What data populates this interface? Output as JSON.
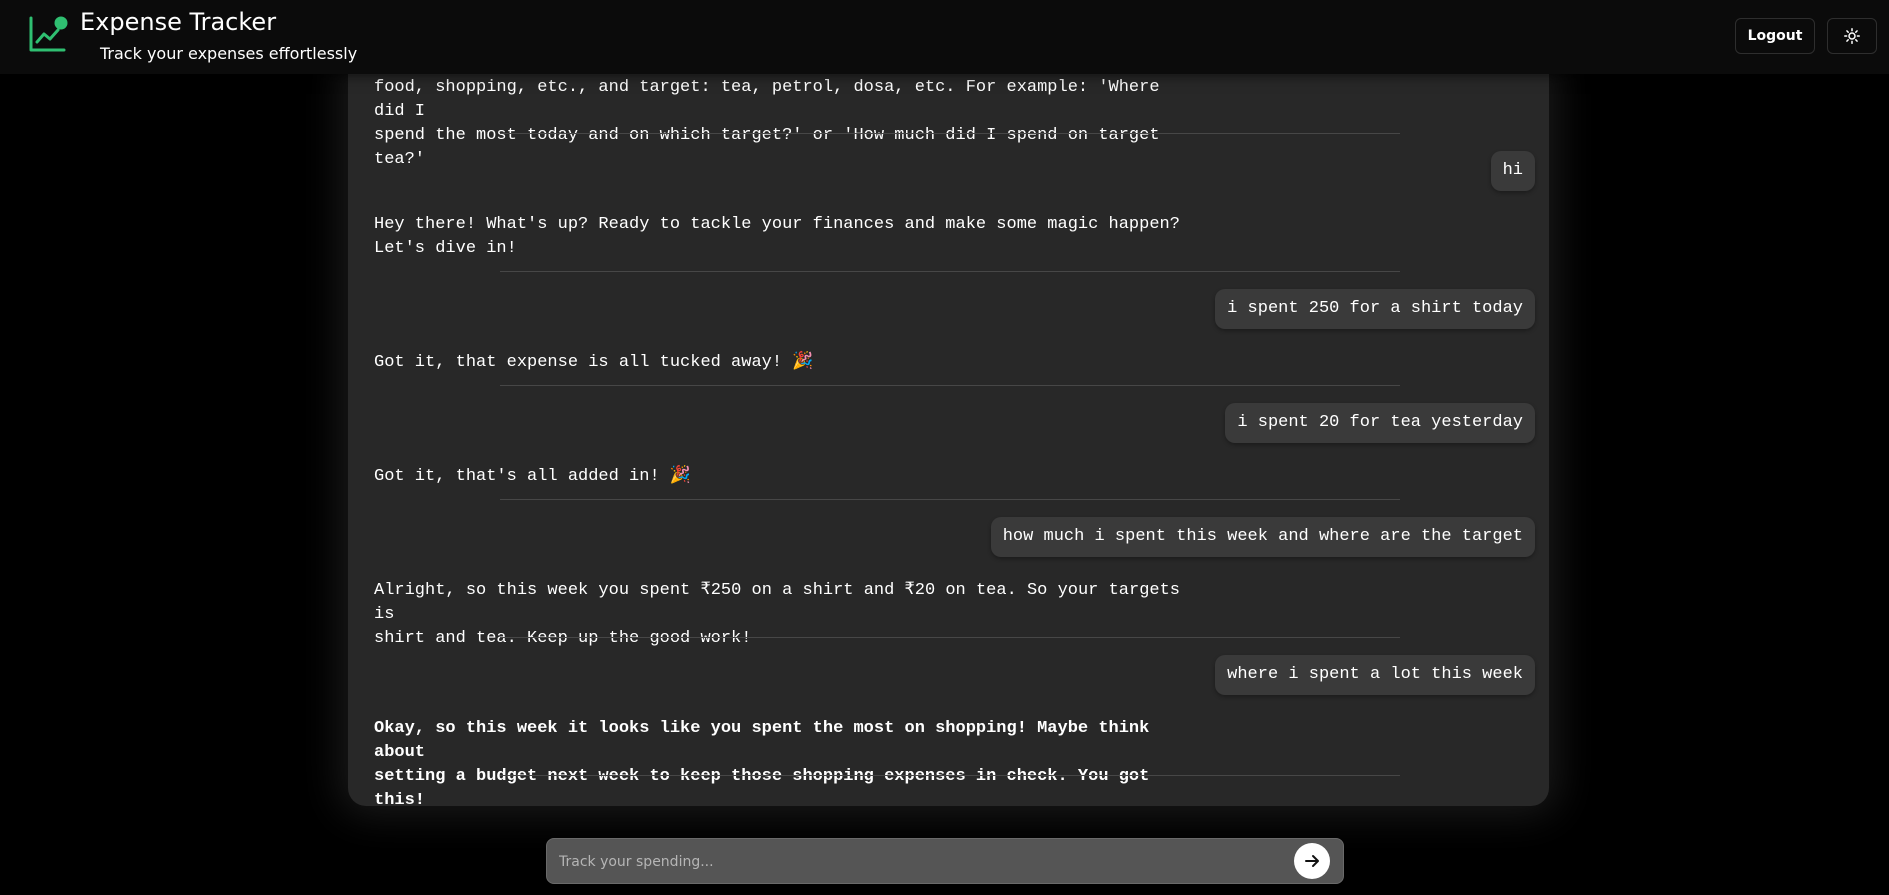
{
  "header": {
    "title": "Expense Tracker",
    "subtitle": "Track your expenses effortlessly",
    "logout_label": "Logout",
    "theme_icon": "sun-icon",
    "logo_icon": "chart-line-icon",
    "accent_color": "#2fbf71"
  },
  "chat": {
    "messages": [
      {
        "role": "bot",
        "text": "food, shopping, etc., and target: tea, petrol, dosa, etc. For example: 'Where did I\nspend the most today and on which target?' or 'How much did I spend on target tea?'"
      },
      {
        "role": "user",
        "text": "hi"
      },
      {
        "role": "bot",
        "text": "Hey there! What's up? Ready to tackle your finances and make some magic happen?\nLet's dive in!"
      },
      {
        "role": "user",
        "text": "i spent 250 for a shirt today"
      },
      {
        "role": "bot",
        "text": "Got it, that expense is all tucked away! 🎉"
      },
      {
        "role": "user",
        "text": "i spent 20 for tea yesterday"
      },
      {
        "role": "bot",
        "text": "Got it, that's all added in! 🎉"
      },
      {
        "role": "user",
        "text": "how much i spent this week and where are the target"
      },
      {
        "role": "bot",
        "text": "Alright, so this week you spent ₹250 on a shirt and ₹20 on tea. So your targets is\nshirt and tea. Keep up the good work!"
      },
      {
        "role": "user",
        "text": "where i spent a lot this week"
      },
      {
        "role": "bot",
        "text": "Okay, so this week it looks like you spent the most on shopping! Maybe think about\nsetting a budget next week to keep those shopping expenses in check. You got this!"
      }
    ]
  },
  "input": {
    "placeholder": "Track your spending...",
    "value": "",
    "send_icon": "arrow-right-icon"
  }
}
